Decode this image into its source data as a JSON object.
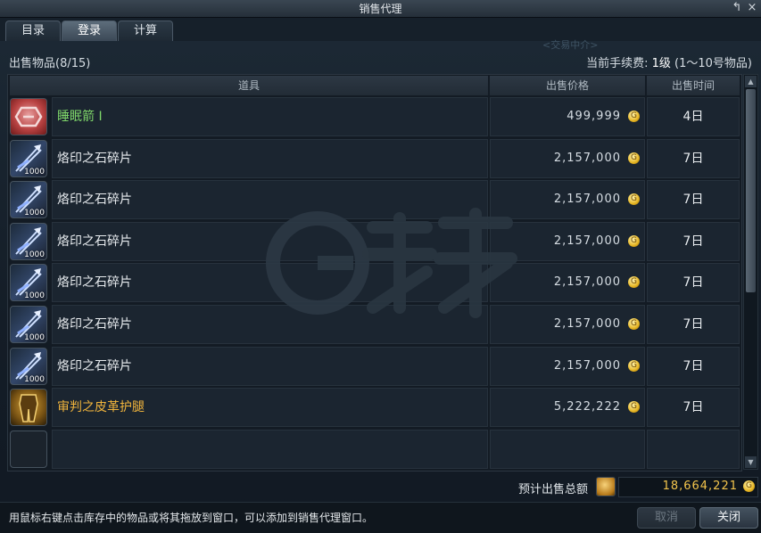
{
  "window": {
    "title": "销售代理",
    "restore_icon": "↰",
    "close_icon": "×"
  },
  "tabs": [
    {
      "label": "目录",
      "active": false
    },
    {
      "label": "登录",
      "active": true
    },
    {
      "label": "计算",
      "active": false
    }
  ],
  "background_text": "<交易中介>",
  "header": {
    "items_label": "出售物品(8/15)",
    "fee_prefix": "当前手续费: ",
    "fee_level": "1级",
    "fee_suffix": " (1～10号物品)"
  },
  "table": {
    "columns": [
      "道具",
      "出售价格",
      "出售时间"
    ],
    "rows": [
      {
        "name": "睡眠箭 I",
        "name_color": "#7fd76a",
        "price": "499,999",
        "time": "4日",
        "icon": "sleep-arrow-icon",
        "qty": ""
      },
      {
        "name": "烙印之石碎片",
        "name_color": "#e8ecef",
        "price": "2,157,000",
        "time": "7日",
        "icon": "brand-stone-shard-icon",
        "qty": "1000"
      },
      {
        "name": "烙印之石碎片",
        "name_color": "#e8ecef",
        "price": "2,157,000",
        "time": "7日",
        "icon": "brand-stone-shard-icon",
        "qty": "1000"
      },
      {
        "name": "烙印之石碎片",
        "name_color": "#e8ecef",
        "price": "2,157,000",
        "time": "7日",
        "icon": "brand-stone-shard-icon",
        "qty": "1000"
      },
      {
        "name": "烙印之石碎片",
        "name_color": "#e8ecef",
        "price": "2,157,000",
        "time": "7日",
        "icon": "brand-stone-shard-icon",
        "qty": "1000"
      },
      {
        "name": "烙印之石碎片",
        "name_color": "#e8ecef",
        "price": "2,157,000",
        "time": "7日",
        "icon": "brand-stone-shard-icon",
        "qty": "1000"
      },
      {
        "name": "烙印之石碎片",
        "name_color": "#e8ecef",
        "price": "2,157,000",
        "time": "7日",
        "icon": "brand-stone-shard-icon",
        "qty": "1000"
      },
      {
        "name": "审判之皮革护腿",
        "name_color": "#f0b43c",
        "price": "5,222,222",
        "time": "7日",
        "icon": "leather-leggings-icon",
        "qty": ""
      },
      {
        "name": "",
        "name_color": "#e8ecef",
        "price": "",
        "time": "",
        "icon": "empty-slot",
        "qty": ""
      }
    ]
  },
  "total": {
    "label": "预计出售总额",
    "value": "18,664,221"
  },
  "footer": {
    "hint": "用鼠标右键点击库存中的物品或将其拖放到窗口，可以添加到销售代理窗口。",
    "cancel_label": "取消",
    "close_label": "关闭"
  },
  "watermark": "G买卖",
  "colors": {
    "gold": "#f2c44c",
    "green_item": "#7fd76a",
    "orange_item": "#f0b43c"
  }
}
